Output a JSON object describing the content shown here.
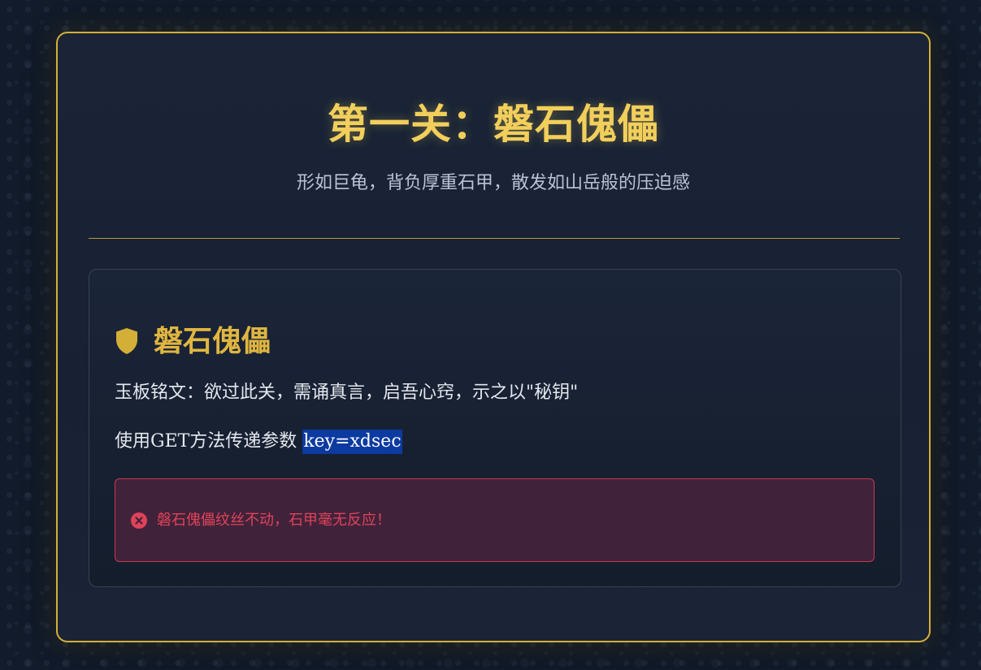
{
  "header": {
    "title": "第一关：磐石傀儡",
    "subtitle": "形如巨龟，背负厚重石甲，散发如山岳般的压迫感"
  },
  "panel": {
    "icon": "shield-icon",
    "title": "磐石傀儡",
    "inscription": "玉板铭文：欲过此关，需诵真言，启吾心窍，示之以\"秘钥\"",
    "instruction_prefix": "使用GET方法传递参数 ",
    "instruction_param": "key=xdsec"
  },
  "alert": {
    "icon": "error-circle-icon",
    "message": "磐石傀儡纹丝不动，石甲毫无反应！"
  },
  "colors": {
    "accent_gold": "#d4af37",
    "title_gold": "#f2cf5b",
    "error_red": "#e0425a",
    "error_bg": "#40233a",
    "background": "#121c2c"
  }
}
